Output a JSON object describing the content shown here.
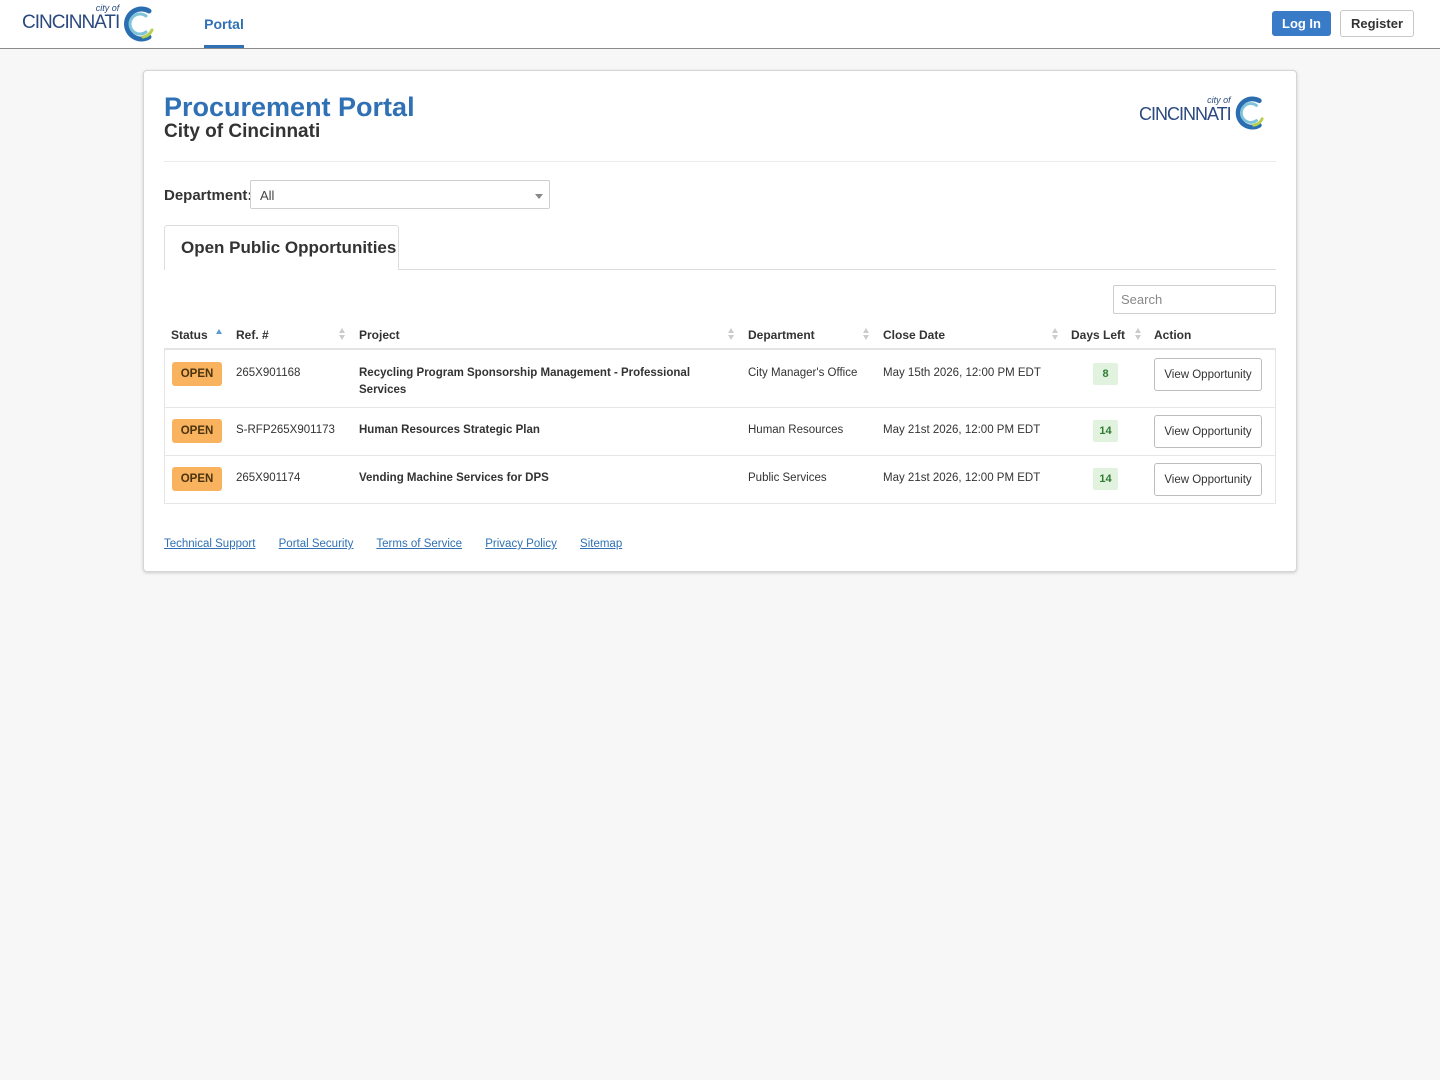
{
  "colors": {
    "brand_blue": "#2f71b4",
    "login_button": "#3a7bc8",
    "open_badge": "#f9b25e",
    "days_left_bg": "#e1f2de",
    "days_left_text": "#2e7d32",
    "page_bg": "#f7f7f7"
  },
  "header": {
    "logo_small_text": "city of",
    "logo_text": "CINCINNATI",
    "logo_icon": "cincinnati-c-logo-icon",
    "nav_portal": "Portal",
    "login_label": "Log In",
    "register_label": "Register"
  },
  "page": {
    "title": "Procurement Portal",
    "subtitle": "City of Cincinnati",
    "logo_small_text": "city of",
    "logo_text": "CINCINNATI",
    "department_label": "Department:",
    "department_value": "All",
    "tab_label": "Open Public Opportunities",
    "search_placeholder": "Search"
  },
  "table": {
    "columns": [
      "Status",
      "Ref. #",
      "Project",
      "Department",
      "Close Date",
      "Days Left",
      "Action"
    ],
    "rows": [
      {
        "status": "OPEN",
        "ref": "265X901168",
        "project": "Recycling Program Sponsorship Management - Professional Services",
        "department": "City Manager's Office",
        "close_date": "May 15th 2026, 12:00 PM EDT",
        "days_left": "8",
        "action": "View Opportunity"
      },
      {
        "status": "OPEN",
        "ref": "S-RFP265X901173",
        "project": "Human Resources Strategic Plan",
        "department": "Human Resources",
        "close_date": "May 21st 2026, 12:00 PM EDT",
        "days_left": "14",
        "action": "View Opportunity"
      },
      {
        "status": "OPEN",
        "ref": "265X901174",
        "project": "Vending Machine Services for DPS",
        "department": "Public Services",
        "close_date": "May 21st 2026, 12:00 PM EDT",
        "days_left": "14",
        "action": "View Opportunity"
      }
    ]
  },
  "footer": {
    "links": [
      "Technical Support",
      "Portal Security",
      "Terms of Service",
      "Privacy Policy",
      "Sitemap"
    ]
  }
}
